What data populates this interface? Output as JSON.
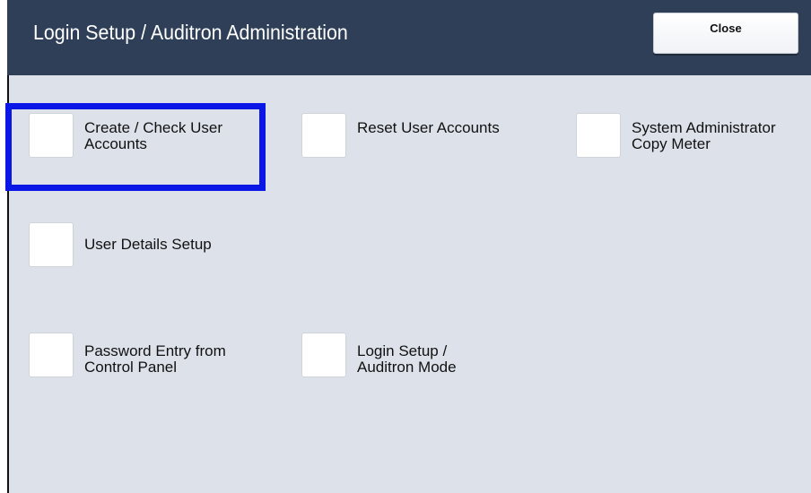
{
  "header": {
    "title": "Login Setup / Auditron Administration",
    "close_label": "Close"
  },
  "options": [
    {
      "label": "Create / Check User Accounts",
      "highlighted": true
    },
    {
      "label": "Reset User Accounts"
    },
    {
      "label": "System Administrator Copy Meter"
    },
    {
      "label": "User Details Setup"
    },
    {
      "label": "Password Entry from Control Panel"
    },
    {
      "label": "Login Setup / Auditron Mode"
    }
  ],
  "colors": {
    "header_bg": "#2f3f57",
    "body_bg": "#dde2ea",
    "highlight": "#0a17e6"
  }
}
